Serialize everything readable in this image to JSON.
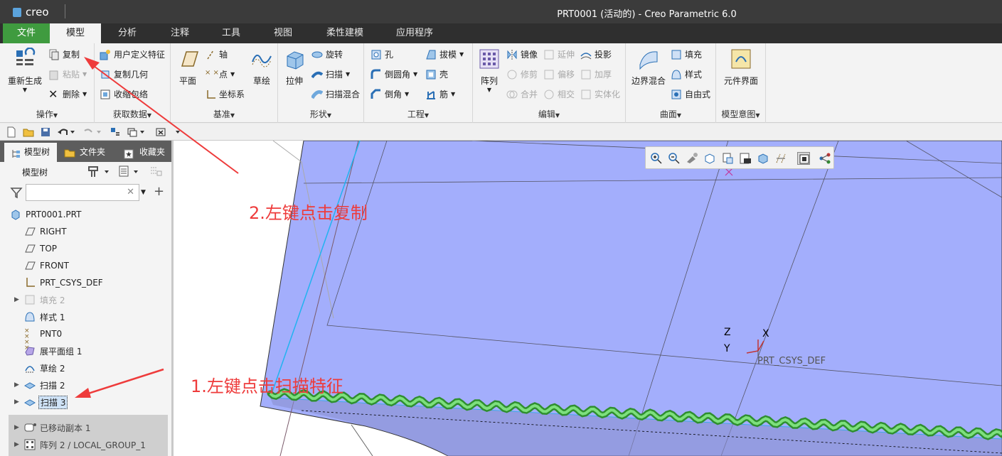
{
  "app": {
    "logo_text": "creo",
    "window_title": "PRT0001 (活动的) - Creo Parametric 6.0"
  },
  "tabs": [
    "文件",
    "模型",
    "分析",
    "注释",
    "工具",
    "视图",
    "柔性建模",
    "应用程序"
  ],
  "ribbon": {
    "operations": {
      "label": "操作",
      "regen": "重新生成",
      "copy": "复制",
      "paste": "粘贴",
      "delete": "删除"
    },
    "get_data": {
      "label": "获取数据",
      "udf": "用户定义特征",
      "copy_geom": "复制几何",
      "shrinkwrap": "收缩包络"
    },
    "datum": {
      "label": "基准",
      "plane": "平面",
      "axis": "轴",
      "point": "点",
      "csys": "坐标系",
      "sketch": "草绘"
    },
    "shapes": {
      "label": "形状",
      "extrude": "拉伸",
      "revolve": "旋转",
      "sweep": "扫描",
      "swept_blend": "扫描混合"
    },
    "engineering": {
      "label": "工程",
      "hole": "孔",
      "round": "倒圆角",
      "chamfer": "倒角",
      "draft": "拔模",
      "shell": "壳",
      "rib": "筋"
    },
    "pattern": {
      "label": "阵列"
    },
    "editing": {
      "label": "编辑",
      "mirror": "镜像",
      "extend": "延伸",
      "project": "投影",
      "trim": "修剪",
      "offset": "偏移",
      "thicken": "加厚",
      "merge": "合并",
      "intersect": "相交",
      "solidify": "实体化"
    },
    "surfaces": {
      "label": "曲面",
      "boundary_blend": "边界混合",
      "fill": "填充",
      "style": "样式",
      "freestyle": "自由式"
    },
    "model_intent": {
      "label": "模型意图",
      "component_interface": "元件界面"
    }
  },
  "panel": {
    "tabs": [
      "模型树",
      "文件夹",
      "收藏夹"
    ],
    "header": "模型树",
    "filter_value": "",
    "tree": [
      {
        "label": "PRT0001.PRT",
        "icon": "part-icon",
        "expand": false,
        "disabled": false
      },
      {
        "label": "RIGHT",
        "icon": "datum-plane-icon",
        "expand": false,
        "disabled": false
      },
      {
        "label": "TOP",
        "icon": "datum-plane-icon",
        "expand": false,
        "disabled": false
      },
      {
        "label": "FRONT",
        "icon": "datum-plane-icon",
        "expand": false,
        "disabled": false
      },
      {
        "label": "PRT_CSYS_DEF",
        "icon": "csys-icon",
        "expand": false,
        "disabled": false
      },
      {
        "label": "填充 2",
        "icon": "fill-icon",
        "expand": true,
        "disabled": true
      },
      {
        "label": "样式 1",
        "icon": "style-icon",
        "expand": false,
        "disabled": false
      },
      {
        "label": "PNT0",
        "icon": "point-icon",
        "expand": false,
        "disabled": false
      },
      {
        "label": "展平面组 1",
        "icon": "flatten-quilt-icon",
        "expand": false,
        "disabled": false
      },
      {
        "label": "草绘 2",
        "icon": "sketch-icon",
        "expand": false,
        "disabled": false
      },
      {
        "label": "扫描 2",
        "icon": "sweep-icon",
        "expand": true,
        "disabled": false
      },
      {
        "label": "扫描 3",
        "icon": "sweep-icon",
        "expand": true,
        "disabled": false,
        "selected": true
      }
    ],
    "grey_items": [
      {
        "label": "已移动副本 1",
        "icon": "moved-copy-icon"
      },
      {
        "label": "阵列 2 / LOCAL_GROUP_1",
        "icon": "pattern-icon"
      }
    ]
  },
  "viewport": {
    "csys_label": "PRT_CSYS_DEF",
    "axis_z": "Z",
    "axis_x": "X",
    "axis_y": "Y"
  },
  "annotations": {
    "step1": "1.左键点击扫描特征",
    "step2": "2.左键点击复制"
  },
  "colors": {
    "surface": "#a3aefc",
    "annotation": "#ee3b3b",
    "file_tab": "#3f9b3f",
    "sweep_green": "#4db84d"
  }
}
